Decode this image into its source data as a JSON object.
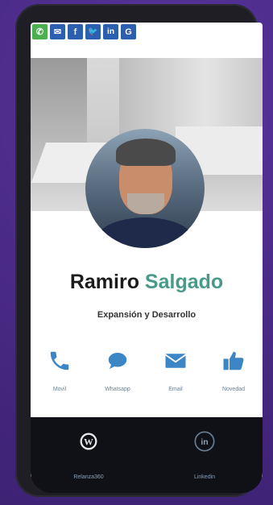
{
  "share_bar": [
    {
      "icon": "whatsapp-icon",
      "glyph": "✆",
      "color": "#4caf50"
    },
    {
      "icon": "email-icon",
      "glyph": "✉",
      "color": "#2d5fb0"
    },
    {
      "icon": "facebook-icon",
      "glyph": "f",
      "color": "#2d5fb0"
    },
    {
      "icon": "twitter-icon",
      "glyph": "🐦",
      "color": "#2d5fb0"
    },
    {
      "icon": "linkedin-icon",
      "glyph": "in",
      "color": "#2d5fb0"
    },
    {
      "icon": "google-icon",
      "glyph": "G",
      "color": "#2d5fb0"
    }
  ],
  "profile": {
    "first_name": "Ramiro",
    "last_name": "Salgado",
    "subtitle": "Expansión y Desarrollo"
  },
  "contact_actions": [
    {
      "icon": "phone-icon",
      "label": "Movil"
    },
    {
      "icon": "chat-icon",
      "label": "Whatsapp"
    },
    {
      "icon": "envelope-icon",
      "label": "Email"
    },
    {
      "icon": "thumbs-up-icon",
      "label": "Novedad"
    }
  ],
  "bottom_links": [
    {
      "icon": "wordpress-icon",
      "label": "Relanza360"
    },
    {
      "icon": "linkedin-circle-icon",
      "label": "Linkedin"
    }
  ],
  "colors": {
    "background": "#4b2a85",
    "accent": "#4a9a8a",
    "icon_blue": "#3d86c6",
    "label_grey": "#6a7f95"
  }
}
